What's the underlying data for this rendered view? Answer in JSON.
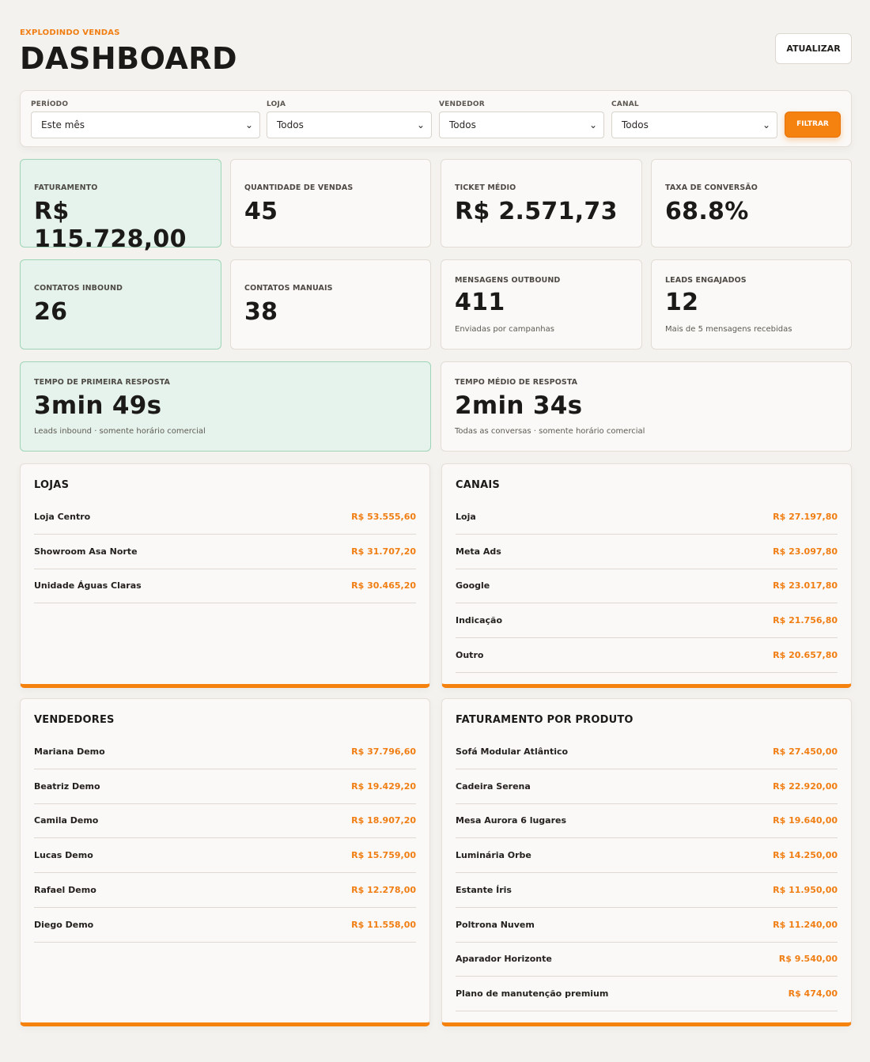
{
  "header": {
    "kicker": "EXPLODINDO VENDAS",
    "title": "DASHBOARD",
    "refresh_label": "ATUALIZAR"
  },
  "filters": {
    "period": {
      "label": "PERÍODO",
      "value": "Este mês"
    },
    "store": {
      "label": "LOJA",
      "value": "Todos"
    },
    "seller": {
      "label": "VENDEDOR",
      "value": "Todos"
    },
    "channel": {
      "label": "CANAL",
      "value": "Todos"
    },
    "apply_label": "FILTRAR"
  },
  "kpis": {
    "revenue": {
      "label": "FATURAMENTO",
      "value": "R$ 115.728,00"
    },
    "sales_count": {
      "label": "QUANTIDADE DE VENDAS",
      "value": "45"
    },
    "avg_ticket": {
      "label": "TICKET MÉDIO",
      "value": "R$ 2.571,73"
    },
    "conversion": {
      "label": "TAXA DE CONVERSÃO",
      "value": "68.8%"
    },
    "inbound": {
      "label": "CONTATOS INBOUND",
      "value": "26"
    },
    "manual": {
      "label": "CONTATOS MANUAIS",
      "value": "38"
    },
    "outbound": {
      "label": "MENSAGENS OUTBOUND",
      "value": "411",
      "sub": "Enviadas por campanhas"
    },
    "engaged": {
      "label": "LEADS ENGAJADOS",
      "value": "12",
      "sub": "Mais de 5 mensagens recebidas"
    },
    "first_response": {
      "label": "TEMPO DE PRIMEIRA RESPOSTA",
      "value": "3min 49s",
      "sub": "Leads inbound · somente horário comercial"
    },
    "avg_response": {
      "label": "TEMPO MÉDIO DE RESPOSTA",
      "value": "2min 34s",
      "sub": "Todas as conversas · somente horário comercial"
    }
  },
  "lojas": {
    "title": "LOJAS",
    "rows": [
      {
        "name": "Loja Centro",
        "value": "R$ 53.555,60"
      },
      {
        "name": "Showroom Asa Norte",
        "value": "R$ 31.707,20"
      },
      {
        "name": "Unidade Águas Claras",
        "value": "R$ 30.465,20"
      }
    ]
  },
  "canais": {
    "title": "CANAIS",
    "rows": [
      {
        "name": "Loja",
        "value": "R$ 27.197,80"
      },
      {
        "name": "Meta Ads",
        "value": "R$ 23.097,80"
      },
      {
        "name": "Google",
        "value": "R$ 23.017,80"
      },
      {
        "name": "Indicação",
        "value": "R$ 21.756,80"
      },
      {
        "name": "Outro",
        "value": "R$ 20.657,80"
      }
    ]
  },
  "vendedores": {
    "title": "VENDEDORES",
    "rows": [
      {
        "name": "Mariana Demo",
        "value": "R$ 37.796,60"
      },
      {
        "name": "Beatriz Demo",
        "value": "R$ 19.429,20"
      },
      {
        "name": "Camila Demo",
        "value": "R$ 18.907,20"
      },
      {
        "name": "Lucas Demo",
        "value": "R$ 15.759,00"
      },
      {
        "name": "Rafael Demo",
        "value": "R$ 12.278,00"
      },
      {
        "name": "Diego Demo",
        "value": "R$ 11.558,00"
      }
    ]
  },
  "produtos": {
    "title": "FATURAMENTO POR PRODUTO",
    "rows": [
      {
        "name": "Sofá Modular Atlântico",
        "value": "R$ 27.450,00"
      },
      {
        "name": "Cadeira Serena",
        "value": "R$ 22.920,00"
      },
      {
        "name": "Mesa Aurora 6 lugares",
        "value": "R$ 19.640,00"
      },
      {
        "name": "Luminária Orbe",
        "value": "R$ 14.250,00"
      },
      {
        "name": "Estante Íris",
        "value": "R$ 11.950,00"
      },
      {
        "name": "Poltrona Nuvem",
        "value": "R$ 11.240,00"
      },
      {
        "name": "Aparador Horizonte",
        "value": "R$ 9.540,00"
      },
      {
        "name": "Plano de manutenção premium",
        "value": "R$ 474,00"
      }
    ]
  },
  "colors": {
    "accent": "#f5810f",
    "highlight_card": "#e6f3ec",
    "highlight_border": "#9fd4b6"
  },
  "icons": {
    "select": "chevron-down-icon"
  }
}
